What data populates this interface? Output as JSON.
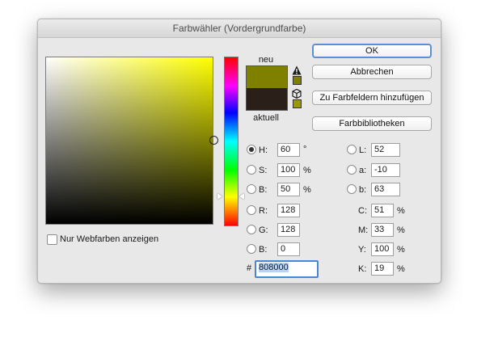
{
  "title": "Farbwähler (Vordergrundfarbe)",
  "swatch": {
    "new_label": "neu",
    "current_label": "aktuell"
  },
  "buttons": {
    "ok": "OK",
    "cancel": "Abbrechen",
    "add_to_swatches": "Zu Farbfeldern hinzufügen",
    "libraries": "Farbbibliotheken"
  },
  "checkbox": {
    "web_colors_label": "Nur Webfarben anzeigen",
    "checked": false
  },
  "hsb": {
    "h": {
      "label": "H:",
      "value": "60",
      "unit": "°",
      "selected": true
    },
    "s": {
      "label": "S:",
      "value": "100",
      "unit": "%"
    },
    "b": {
      "label": "B:",
      "value": "50",
      "unit": "%"
    }
  },
  "rgb": {
    "r": {
      "label": "R:",
      "value": "128"
    },
    "g": {
      "label": "G:",
      "value": "128"
    },
    "b": {
      "label": "B:",
      "value": "0"
    }
  },
  "lab": {
    "l": {
      "label": "L:",
      "value": "52"
    },
    "a": {
      "label": "a:",
      "value": "-10"
    },
    "b": {
      "label": "b:",
      "value": "63"
    }
  },
  "cmyk": {
    "c": {
      "label": "C:",
      "value": "51",
      "unit": "%"
    },
    "m": {
      "label": "M:",
      "value": "33",
      "unit": "%"
    },
    "y": {
      "label": "Y:",
      "value": "100",
      "unit": "%"
    },
    "k": {
      "label": "K:",
      "value": "19",
      "unit": "%"
    }
  },
  "hex": {
    "label": "#",
    "value": "808000"
  },
  "colors": {
    "new_color": "#808000",
    "current_color": "#2b1f1a",
    "gamut_swatch": "#808000",
    "web_swatch": "#999900",
    "focus": "#5a8fd6"
  },
  "icons": {
    "gamut_warning": "warning-triangle-icon",
    "web_safe": "cube-icon"
  }
}
